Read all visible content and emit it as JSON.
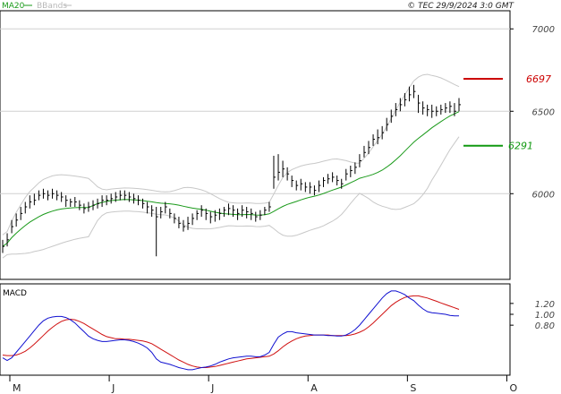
{
  "header": {
    "legend": [
      {
        "label": "MA20",
        "color": "#1a9a1a"
      },
      {
        "label": "BBands",
        "color": "#b8b8b8"
      }
    ],
    "copyright": "© TEC 29/9/2024 3:0 GMT"
  },
  "colors": {
    "price": "#000000",
    "ma20": "#1a9a1a",
    "bbands": "#c8c8c8",
    "macd": "#1010d0",
    "signal": "#d01010",
    "resistance": "#cc0000",
    "support": "#119911",
    "grid": "#d0d0d0",
    "frame": "#000000"
  },
  "chart_data": [
    {
      "type": "ohlc",
      "x_axis": {
        "tick_labels": [
          "M",
          "J",
          "J",
          "A",
          "S",
          "O"
        ],
        "tick_days": [
          0,
          22,
          44,
          66,
          88,
          110
        ]
      },
      "y_axis": {
        "tick_labels": [
          "6000",
          "6500",
          "7000"
        ],
        "tick_values": [
          6000,
          6500,
          7000
        ],
        "ylim": [
          5480,
          7110
        ]
      },
      "levels": [
        {
          "label": "6697",
          "value": 6697,
          "color": "#cc0000"
        },
        {
          "label": "6291",
          "value": 6291,
          "color": "#119911"
        }
      ],
      "close": [
        5680,
        5720,
        5800,
        5840,
        5880,
        5920,
        5950,
        5960,
        5990,
        6000,
        5990,
        6000,
        5990,
        5980,
        5960,
        5950,
        5950,
        5930,
        5910,
        5920,
        5930,
        5940,
        5960,
        5960,
        5970,
        5980,
        5990,
        5990,
        5980,
        5970,
        5960,
        5940,
        5920,
        5900,
        5860,
        5890,
        5920,
        5880,
        5850,
        5820,
        5800,
        5820,
        5850,
        5880,
        5900,
        5880,
        5860,
        5870,
        5880,
        5900,
        5910,
        5900,
        5880,
        5900,
        5890,
        5880,
        5860,
        5870,
        5900,
        5920,
        6100,
        6130,
        6150,
        6120,
        6080,
        6050,
        6060,
        6040,
        6040,
        6020,
        6050,
        6080,
        6090,
        6100,
        6080,
        6060,
        6120,
        6140,
        6160,
        6200,
        6250,
        6280,
        6330,
        6340,
        6370,
        6420,
        6470,
        6510,
        6540,
        6570,
        6600,
        6620,
        6550,
        6520,
        6510,
        6500,
        6500,
        6510,
        6520,
        6530,
        6500,
        6540
      ],
      "high": [
        5720,
        5760,
        5840,
        5880,
        5920,
        5950,
        5990,
        6000,
        6020,
        6030,
        6020,
        6030,
        6020,
        6010,
        5990,
        5970,
        5980,
        5960,
        5940,
        5950,
        5960,
        5970,
        5990,
        5990,
        6000,
        6010,
        6020,
        6020,
        6010,
        6000,
        5990,
        5970,
        5950,
        5930,
        5920,
        5920,
        5950,
        5910,
        5880,
        5860,
        5840,
        5860,
        5880,
        5900,
        5930,
        5910,
        5890,
        5900,
        5910,
        5920,
        5940,
        5930,
        5910,
        5930,
        5920,
        5910,
        5890,
        5900,
        5920,
        5950,
        6230,
        6240,
        6200,
        6160,
        6110,
        6080,
        6090,
        6070,
        6070,
        6050,
        6080,
        6100,
        6120,
        6130,
        6110,
        6090,
        6150,
        6170,
        6190,
        6240,
        6290,
        6320,
        6360,
        6390,
        6410,
        6460,
        6510,
        6550,
        6580,
        6610,
        6650,
        6660,
        6600,
        6560,
        6540,
        6540,
        6530,
        6540,
        6550,
        6560,
        6550,
        6580
      ],
      "low": [
        5640,
        5680,
        5760,
        5800,
        5840,
        5880,
        5910,
        5930,
        5960,
        5970,
        5960,
        5970,
        5960,
        5950,
        5920,
        5920,
        5920,
        5900,
        5880,
        5890,
        5900,
        5910,
        5920,
        5930,
        5940,
        5950,
        5960,
        5960,
        5950,
        5940,
        5930,
        5910,
        5880,
        5860,
        5620,
        5850,
        5880,
        5850,
        5820,
        5790,
        5770,
        5780,
        5810,
        5840,
        5860,
        5840,
        5820,
        5830,
        5840,
        5860,
        5870,
        5860,
        5840,
        5860,
        5850,
        5840,
        5830,
        5840,
        5870,
        5890,
        6030,
        6080,
        6100,
        6080,
        6040,
        6020,
        6020,
        6010,
        6000,
        5990,
        6010,
        6040,
        6060,
        6070,
        6050,
        6030,
        6080,
        6100,
        6120,
        6160,
        6220,
        6240,
        6290,
        6300,
        6330,
        6380,
        6430,
        6470,
        6500,
        6530,
        6560,
        6580,
        6490,
        6480,
        6470,
        6460,
        6470,
        6480,
        6490,
        6490,
        6470,
        6500
      ]
    },
    {
      "type": "line",
      "title": "MACD",
      "y_axis": {
        "tick_labels": [
          "0.80",
          "1.00",
          "1.20"
        ],
        "tick_values": [
          0.8,
          1.0,
          1.2
        ],
        "ylim": [
          -0.12,
          1.56
        ]
      },
      "series": [
        {
          "name": "MACD",
          "color": "#1010d0",
          "values": [
            0.2,
            0.15,
            0.2,
            0.3,
            0.4,
            0.5,
            0.6,
            0.7,
            0.8,
            0.88,
            0.93,
            0.95,
            0.96,
            0.96,
            0.94,
            0.9,
            0.84,
            0.76,
            0.68,
            0.6,
            0.55,
            0.52,
            0.5,
            0.5,
            0.51,
            0.52,
            0.53,
            0.53,
            0.52,
            0.5,
            0.47,
            0.43,
            0.38,
            0.3,
            0.18,
            0.12,
            0.1,
            0.08,
            0.05,
            0.02,
            0.0,
            -0.02,
            -0.02,
            0.0,
            0.02,
            0.03,
            0.05,
            0.08,
            0.12,
            0.15,
            0.18,
            0.2,
            0.21,
            0.22,
            0.23,
            0.23,
            0.22,
            0.22,
            0.25,
            0.3,
            0.45,
            0.58,
            0.64,
            0.68,
            0.68,
            0.66,
            0.65,
            0.64,
            0.63,
            0.62,
            0.62,
            0.62,
            0.61,
            0.61,
            0.6,
            0.6,
            0.62,
            0.66,
            0.72,
            0.8,
            0.9,
            1.0,
            1.1,
            1.2,
            1.3,
            1.38,
            1.43,
            1.43,
            1.4,
            1.36,
            1.3,
            1.25,
            1.17,
            1.1,
            1.05,
            1.03,
            1.02,
            1.01,
            1.0,
            0.98,
            0.97,
            0.97
          ]
        },
        {
          "name": "Signal",
          "color": "#d01010",
          "values": [
            0.25,
            0.24,
            0.24,
            0.25,
            0.28,
            0.32,
            0.38,
            0.45,
            0.53,
            0.61,
            0.69,
            0.76,
            0.82,
            0.87,
            0.9,
            0.91,
            0.9,
            0.87,
            0.83,
            0.78,
            0.73,
            0.68,
            0.63,
            0.59,
            0.57,
            0.55,
            0.55,
            0.54,
            0.54,
            0.53,
            0.52,
            0.51,
            0.49,
            0.46,
            0.41,
            0.36,
            0.31,
            0.26,
            0.21,
            0.16,
            0.12,
            0.08,
            0.05,
            0.03,
            0.02,
            0.02,
            0.03,
            0.04,
            0.06,
            0.08,
            0.1,
            0.12,
            0.14,
            0.16,
            0.18,
            0.19,
            0.2,
            0.21,
            0.22,
            0.23,
            0.27,
            0.33,
            0.4,
            0.46,
            0.51,
            0.55,
            0.58,
            0.6,
            0.61,
            0.62,
            0.62,
            0.62,
            0.62,
            0.61,
            0.61,
            0.61,
            0.61,
            0.62,
            0.64,
            0.67,
            0.71,
            0.77,
            0.84,
            0.92,
            1.0,
            1.08,
            1.16,
            1.22,
            1.27,
            1.31,
            1.33,
            1.34,
            1.34,
            1.32,
            1.3,
            1.27,
            1.24,
            1.21,
            1.18,
            1.15,
            1.12,
            1.09
          ]
        }
      ]
    }
  ]
}
